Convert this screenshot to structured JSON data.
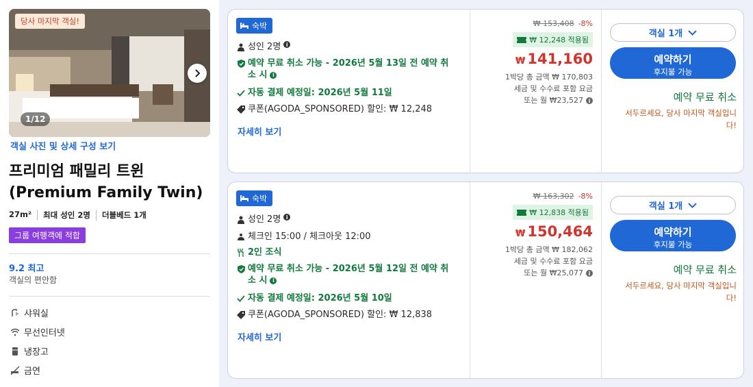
{
  "room": {
    "last_room_badge": "당사 마지막 객실!",
    "photo_counter": "1/12",
    "photo_link": "객실 사진 및 상세 구성 보기",
    "title_line1": "프리미엄 패밀리 트윈",
    "title_line2": "(Premium Family Twin)",
    "specs": [
      "27m²",
      "최대 성인 2명",
      "더블베드 1개"
    ],
    "group_badge": "그룹 여행객에 적합",
    "score": "9.2 최고",
    "score_sub": "객실의 편안함",
    "amenities": [
      {
        "icon": "shower-icon",
        "label": "샤워실"
      },
      {
        "icon": "wifi-icon",
        "label": "무선인터넷"
      },
      {
        "icon": "fridge-icon",
        "label": "냉장고"
      },
      {
        "icon": "no-smoking-icon",
        "label": "금연"
      }
    ]
  },
  "offers": [
    {
      "badge": "숙박",
      "guests": "성인 2명",
      "free_cancel": "예약 무료 취소 가능 - 2026년 5월 13일 전 예약 취소 시",
      "free_cancel_line1": "예약 무료 취소 가능 - 2026년 5월 13일 전 예약 취",
      "free_cancel_line2": "소 시",
      "autopay": "자동 결제 예정일: 2026년 5월 11일",
      "coupon": "쿠폰(AGODA_SPONSORED) 할인: ₩ 12,248",
      "details": "자세히 보기",
      "original_price": "₩ 153,408",
      "discount_pct": "-8%",
      "coupon_applied": "₩ 12,248 적용됨",
      "currency": "₩",
      "price": "141,160",
      "total_line": "1박당 총 금액 ₩ 170,803",
      "tax_line": "세금 및 수수료 포함 요금",
      "monthly_line": "또는 월 ₩23,527",
      "rooms_select": "객실 1개",
      "book_label": "예약하기",
      "book_sub": "후지불 가능",
      "free_cancel_side": "예약 무료 취소",
      "urgency_line1": "서두르세요, 당사 마지막 객실입니",
      "urgency_line2": "다!"
    },
    {
      "badge": "숙박",
      "guests": "성인 2명",
      "checkin": "체크인 15:00 / 체크아웃 12:00",
      "breakfast": "2인 조식",
      "free_cancel_line1": "예약 무료 취소 가능 - 2026년 5월 12일 전 예약 취",
      "free_cancel_line2": "소 시",
      "autopay": "자동 결제 예정일: 2026년 5월 10일",
      "coupon": "쿠폰(AGODA_SPONSORED) 할인: ₩ 12,838",
      "details": "자세히 보기",
      "original_price": "₩ 163,302",
      "discount_pct": "-8%",
      "coupon_applied": "₩ 12,838 적용됨",
      "currency": "₩",
      "price": "150,464",
      "total_line": "1박당 총 금액 ₩ 182,062",
      "tax_line": "세금 및 수수료 포함 요금",
      "monthly_line": "또는 월 ₩25,077",
      "rooms_select": "객실 1개",
      "book_label": "예약하기",
      "book_sub": "후지불 가능",
      "free_cancel_side": "예약 무료 취소",
      "urgency_line1": "서두르세요, 당사 마지막 객실입니",
      "urgency_line2": "다!"
    }
  ],
  "colors": {
    "accent": "#1f68d6",
    "price_red": "#d0342c",
    "green": "#117a3c",
    "purple_badge": "#8a3ee0"
  }
}
